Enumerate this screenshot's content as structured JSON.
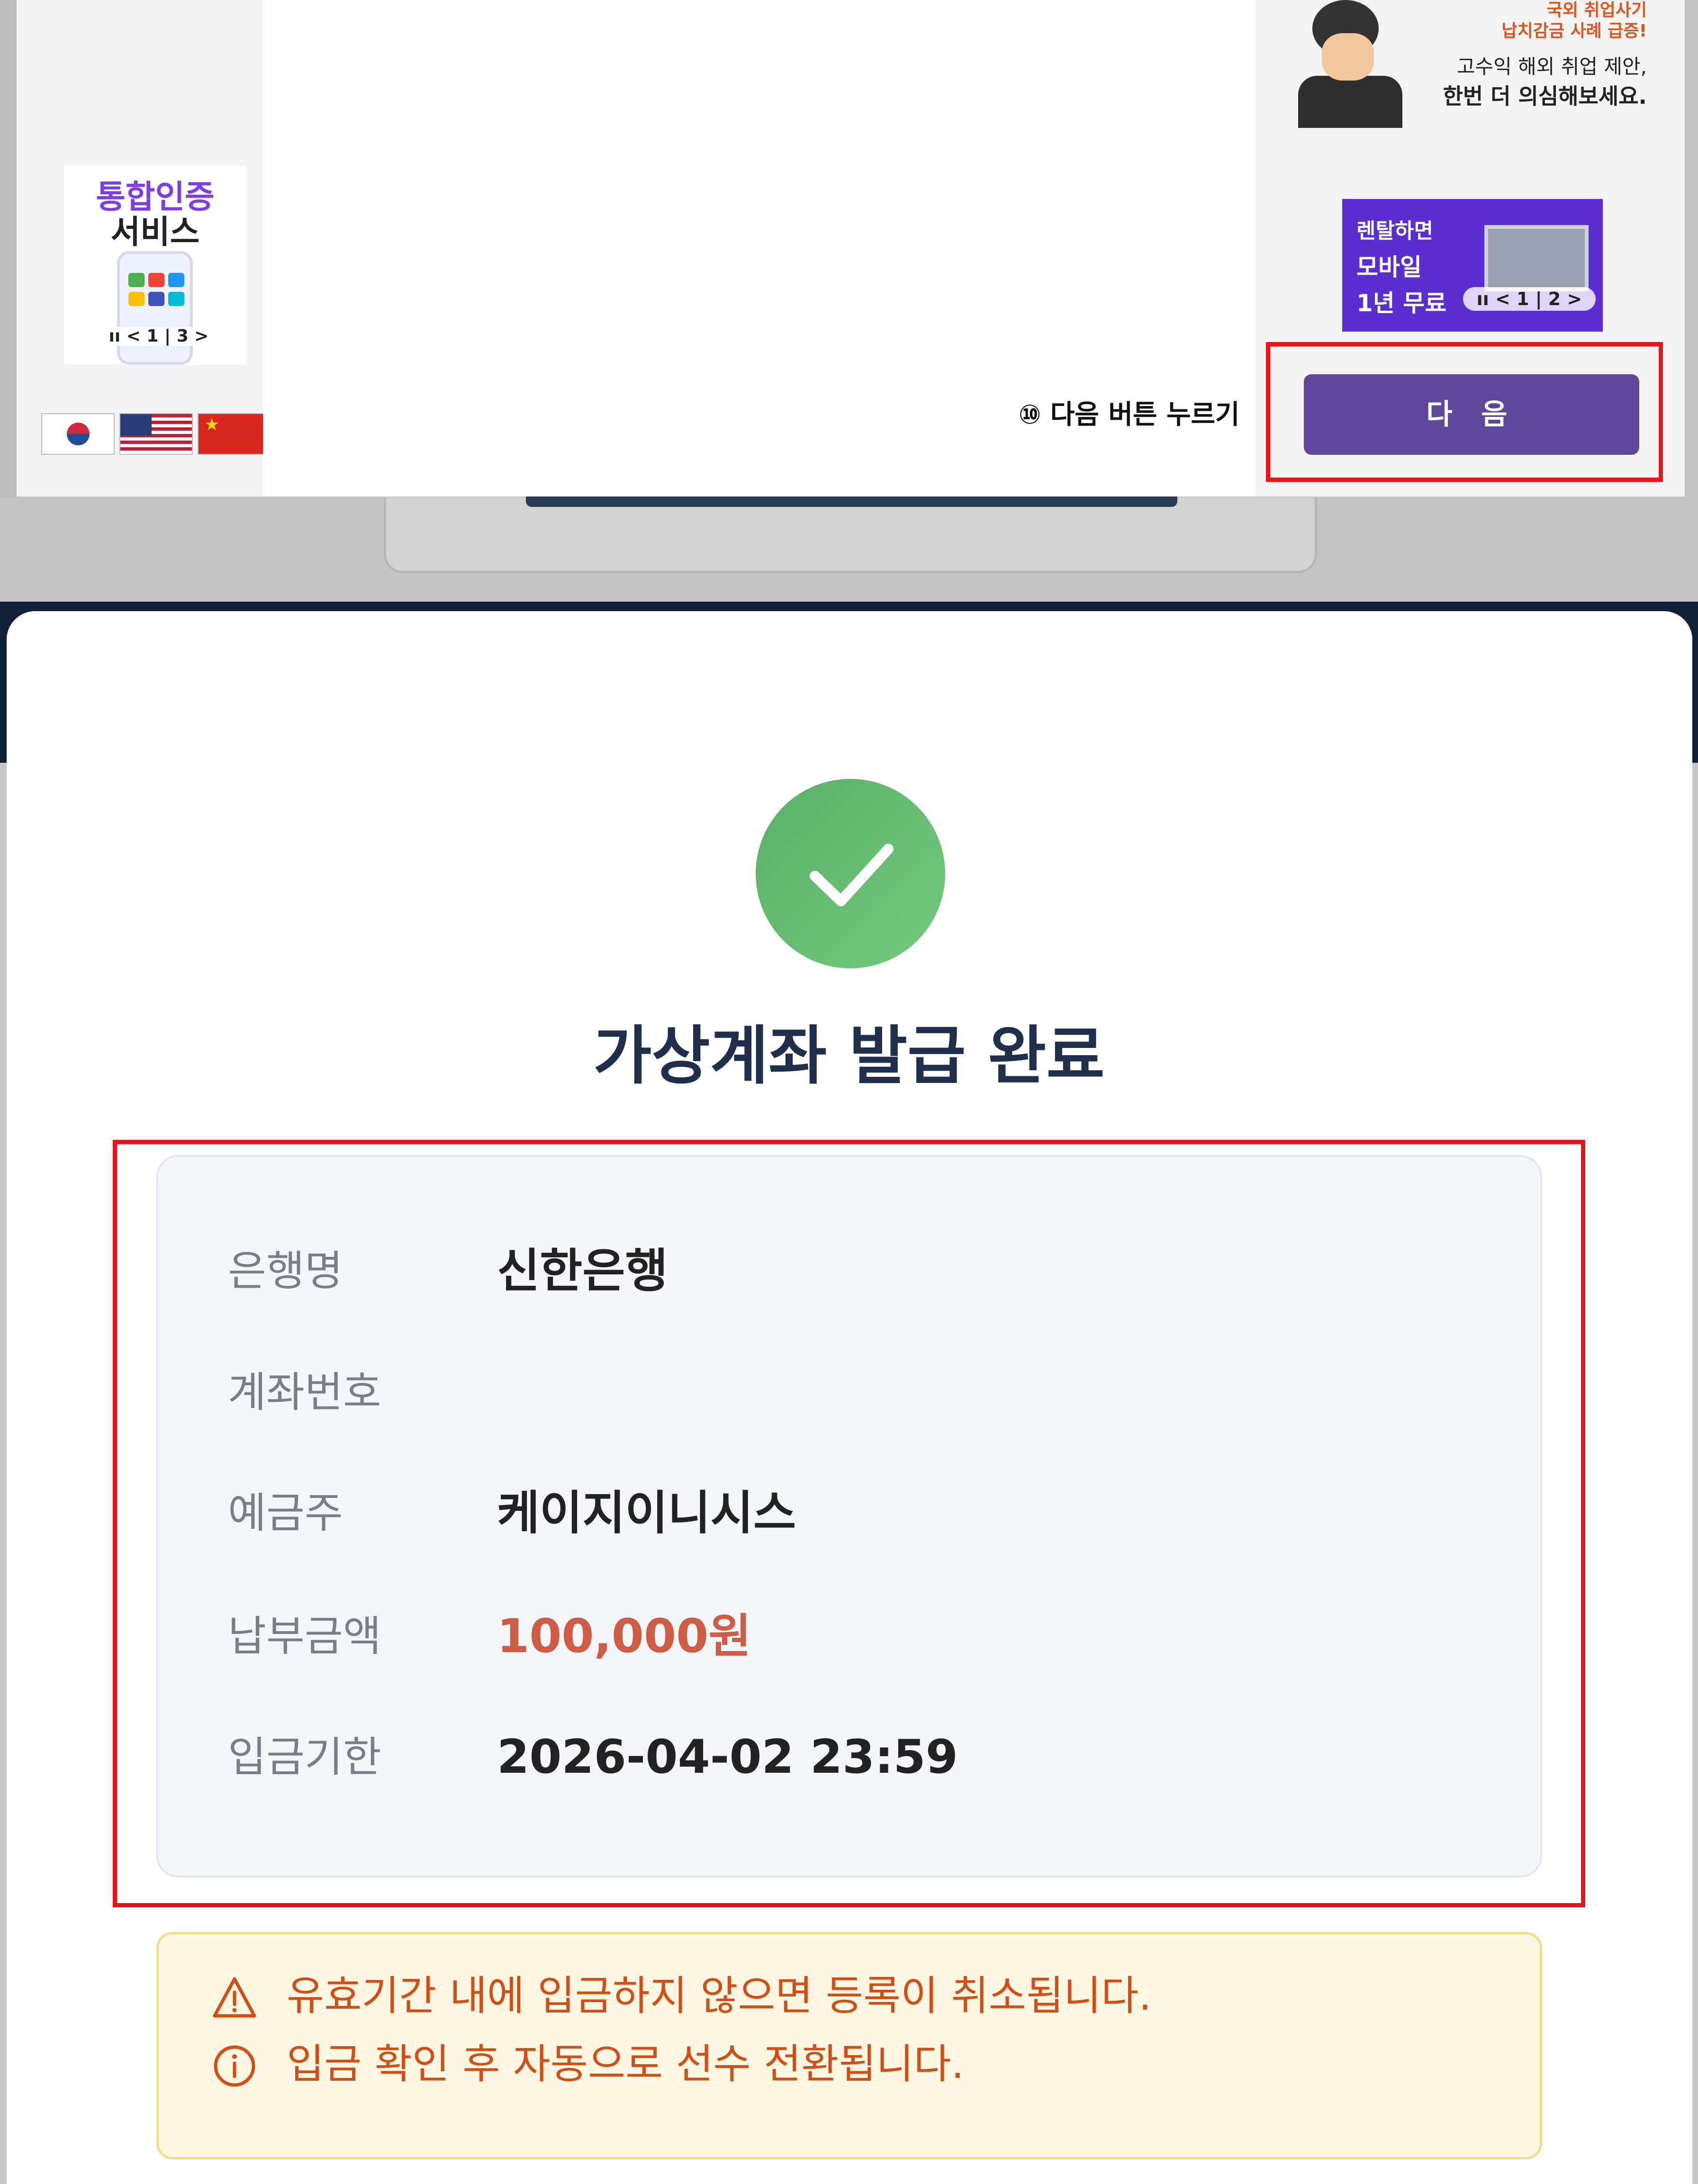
{
  "top_screenshot": {
    "left_promo": {
      "line1": "통합인증",
      "line2": "서비스",
      "pager": "ıı < 1 | 3 >"
    },
    "flags": [
      "korea-flag-icon",
      "usa-flag-icon",
      "china-flag-icon"
    ],
    "right_ad_top": {
      "text_red_1": "국외 취업사기",
      "text_red_2": "납치감금 사례 급증!",
      "text_dark_1": "고수익 해외 취업 제안,",
      "text_dark_2": "한번 더 의심해보세요."
    },
    "right_ad_rental": {
      "line1": "렌탈하면",
      "line2": "모바일",
      "line3": "1년 무료",
      "pager": "ıı < 1 | 2 >"
    },
    "step_label": "⑩ 다음 버튼 누르기",
    "next_button": "다 음"
  },
  "modal": {
    "title": "가상계좌 발급 완료",
    "info": [
      {
        "label": "은행명",
        "value": "신한은행"
      },
      {
        "label": "계좌번호",
        "value": ""
      },
      {
        "label": "예금주",
        "value": "케이지이니시스"
      },
      {
        "label": "납부금액",
        "value": "100,000원"
      },
      {
        "label": "입금기한",
        "value": "2026-04-02 23:59"
      }
    ],
    "notices": [
      {
        "icon": "warning-icon",
        "text": "유효기간 내에 입금하지 않으면 등록이 취소됩니다."
      },
      {
        "icon": "info-icon",
        "text": "입금 확인 후 자동으로 선수 전환됩니다."
      }
    ]
  },
  "colors": {
    "accent_purple": "#5f4699",
    "highlight_red": "#e7141b",
    "success_green": "#66bd73",
    "amount_red": "#cf5c44",
    "notice_orange": "#d24e16",
    "title_navy": "#1f2e4a"
  }
}
